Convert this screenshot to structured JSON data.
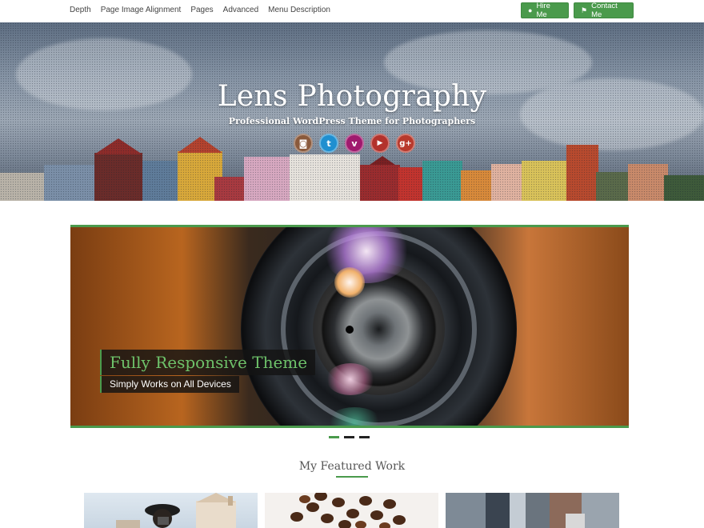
{
  "nav": {
    "menu": [
      "Depth",
      "Page Image Alignment",
      "Pages",
      "Advanced",
      "Menu Description"
    ],
    "hire_label": "Hire Me",
    "contact_label": "Contact Me",
    "accent": "#4a9a4c"
  },
  "hero": {
    "title": "Lens Photography",
    "tagline": "Professional WordPress Theme for Photographers",
    "social": [
      {
        "icon": "instagram-icon",
        "glyph": "◙",
        "color": "#8a5a3c"
      },
      {
        "icon": "twitter-icon",
        "glyph": "t",
        "color": "#1f8fd0"
      },
      {
        "icon": "vimeo-icon",
        "glyph": "v",
        "color": "#a01a6e"
      },
      {
        "icon": "youtube-icon",
        "glyph": "▶",
        "color": "#b3322c"
      },
      {
        "icon": "google-plus-icon",
        "glyph": "g+",
        "color": "#b8392c"
      }
    ]
  },
  "slider": {
    "caption_title": "Fully Responsive Theme",
    "caption_subtitle": "Simply Works on All Devices",
    "slide_count": 3,
    "active_slide": 1
  },
  "featured": {
    "heading": "My Featured Work"
  }
}
